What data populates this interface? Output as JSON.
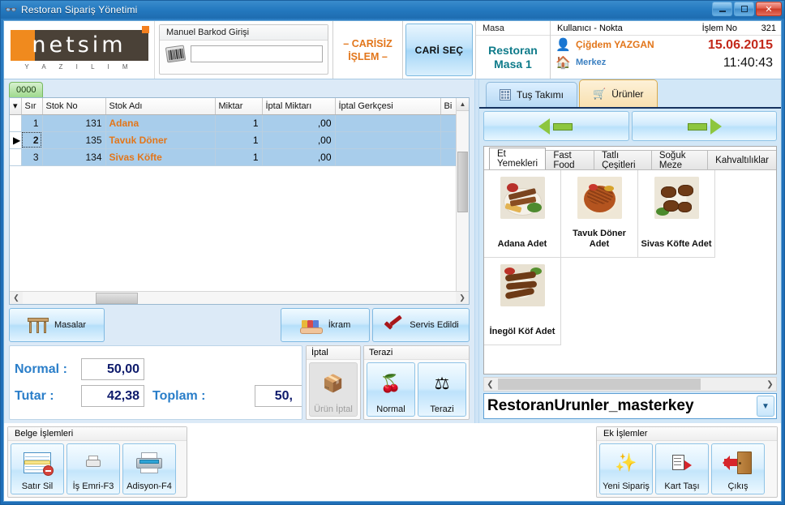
{
  "window": {
    "title": "Restoran Sipariş Yönetimi",
    "app_icon": "butterfly-icon",
    "minimize": "_",
    "maximize": "□",
    "close": "✕"
  },
  "header": {
    "logo": {
      "text": "netsim",
      "sub": "Y A Z I L I M"
    },
    "barcode": {
      "title": "Manuel Barkod Girişi",
      "icon": "barcode-icon",
      "value": "",
      "placeholder": ""
    },
    "carisiz_label": "– CARİSİZ\nİŞLEM –",
    "carisiz_line1": "– CARİSİZ",
    "carisiz_line2": "İŞLEM –",
    "cari_sec_button": "CARİ SEÇ",
    "masa": {
      "label": "Masa",
      "line1": "Restoran",
      "line2": "Masa 1"
    },
    "user": {
      "label": "Kullanıcı - Nokta",
      "islem_no_label": "İşlem No",
      "islem_no_value": "321",
      "user_icon": "user-avatar-icon",
      "user_name": "Çiğdem YAZGAN",
      "branch_icon": "home-icon",
      "branch_name": "Merkez",
      "date": "15.06.2015",
      "time": "11:40:43"
    }
  },
  "left": {
    "sheet_tab": "0000",
    "grid": {
      "columns": [
        "Sır",
        "Stok No",
        "Stok Adı",
        "Miktar",
        "İptal Miktarı",
        "İptal Gerkçesi",
        "Bi"
      ],
      "rows": [
        {
          "indicator": "",
          "sira": "1",
          "stok_no": "131",
          "stok_adi": "Adana",
          "miktar": "1",
          "iptal_miktari": ",00",
          "iptal_gerekcesi": "",
          "bi": ""
        },
        {
          "indicator": "▶",
          "sira": "2",
          "stok_no": "135",
          "stok_adi": "Tavuk Döner",
          "miktar": "1",
          "iptal_miktari": ",00",
          "iptal_gerekcesi": "",
          "bi": ""
        },
        {
          "indicator": "",
          "sira": "3",
          "stok_no": "134",
          "stok_adi": "Sivas Köfte",
          "miktar": "1",
          "iptal_miktari": ",00",
          "iptal_gerekcesi": "",
          "bi": ""
        }
      ]
    },
    "actions": {
      "masalar": {
        "label": "Masalar",
        "icon": "table-furniture-icon"
      },
      "ikram": {
        "label": "İkram",
        "icon": "serving-hand-icon"
      },
      "servis": {
        "label": "Servis Edildi",
        "icon": "red-check-icon"
      }
    },
    "totals": {
      "normal_label": "Normal :",
      "normal_value": "50,00",
      "tutar_label": "Tutar :",
      "tutar_value": "42,38",
      "toplam_label": "Toplam :",
      "toplam_value": "50,"
    },
    "iptal_group": {
      "title": "İptal",
      "buttons": [
        {
          "label": "Ürün İptal",
          "icon": "cancel-product-icon",
          "disabled": true
        }
      ]
    },
    "terazi_group": {
      "title": "Terazi",
      "buttons": [
        {
          "label": "Normal",
          "icon": "fruits-icon",
          "disabled": false
        },
        {
          "label": "Terazi",
          "icon": "scale-icon",
          "disabled": false
        }
      ]
    }
  },
  "right": {
    "tabs": [
      {
        "label": "Tuş Takımı",
        "icon": "keypad-icon",
        "active": false
      },
      {
        "label": "Ürünler",
        "icon": "cart-icon",
        "active": true
      }
    ],
    "nav": {
      "prev_icon": "arrow-left-icon",
      "next_icon": "arrow-right-icon"
    },
    "category_tabs": [
      {
        "label": "Et Yemekleri",
        "active": true
      },
      {
        "label": "Fast Food",
        "active": false
      },
      {
        "label": "Tatlı Çeşitleri",
        "active": false
      },
      {
        "label": "Soğuk Meze",
        "active": false
      },
      {
        "label": "Kahvaltılıklar",
        "active": false
      }
    ],
    "products": [
      {
        "name": "Adana Adet",
        "image": "adana-kebab-photo"
      },
      {
        "name": "Tavuk Döner Adet",
        "image": "chicken-doner-photo"
      },
      {
        "name": "Sivas Köfte Adet",
        "image": "sivas-kofte-photo"
      },
      {
        "name": "İnegöl Köf Adet",
        "image": "inegol-kofte-photo"
      }
    ],
    "combo": {
      "value": "RestoranUrunler_masterkey",
      "arrow_icon": "chevron-down-icon"
    }
  },
  "bottom": {
    "belge": {
      "title": "Belge İşlemleri",
      "buttons": [
        {
          "label": "Satır Sil",
          "icon": "delete-row-icon"
        },
        {
          "label": "İş Emri-F3",
          "icon": "printer-small-icon"
        },
        {
          "label": "Adisyon-F4",
          "icon": "printer-icon"
        }
      ]
    },
    "ek": {
      "title": "Ek İşlemler",
      "buttons": [
        {
          "label": "Yeni Sipariş",
          "icon": "new-star-icon"
        },
        {
          "label": "Kart Taşı",
          "icon": "card-move-icon"
        },
        {
          "label": "Çıkış",
          "icon": "exit-door-icon"
        }
      ]
    }
  }
}
